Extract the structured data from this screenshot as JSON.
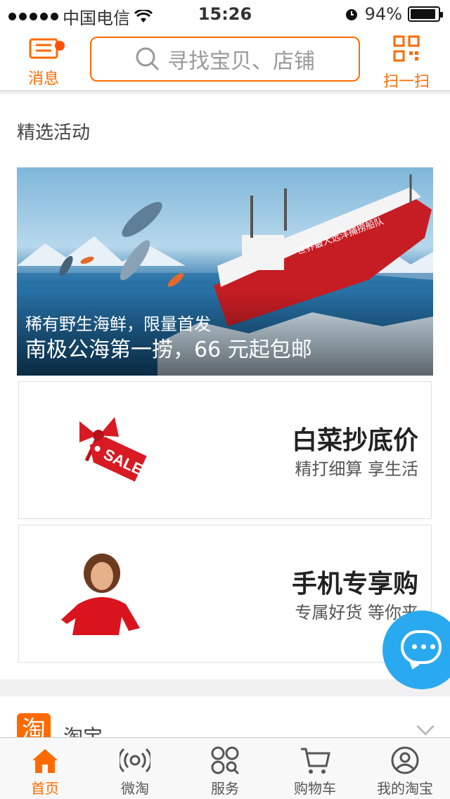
{
  "status_bar": {
    "carrier": "中国电信",
    "time": "15:26",
    "battery_text": "94%",
    "battery_level": 0.94
  },
  "header": {
    "message_label": "消息",
    "search_placeholder": "寻找宝贝、店铺",
    "scan_label": "扫一扫"
  },
  "featured": {
    "title": "精选活动",
    "banner_sub": "稀有野生海鲜，限量首发",
    "banner_main": "南极公海第一捞，66 元起包邮",
    "banner_ship_text": "世界最大远洋捕捞船队",
    "promos": [
      {
        "title": "白菜抄底价",
        "subtitle": "精打细算 享生活",
        "image_text": "SALE"
      },
      {
        "title": "手机专享购",
        "subtitle": "专属好货 等你来"
      }
    ]
  },
  "taobao_section": {
    "logo_char": "淘",
    "name": "淘宝"
  },
  "tabs": [
    {
      "label": "首页",
      "icon": "home-icon",
      "active": true
    },
    {
      "label": "微淘",
      "icon": "broadcast-icon",
      "active": false
    },
    {
      "label": "服务",
      "icon": "grid-icon",
      "active": false
    },
    {
      "label": "购物车",
      "icon": "cart-icon",
      "active": false
    },
    {
      "label": "我的淘宝",
      "icon": "profile-icon",
      "active": false
    }
  ],
  "colors": {
    "accent": "#ff6a00",
    "chat_blue": "#29a9f0"
  }
}
